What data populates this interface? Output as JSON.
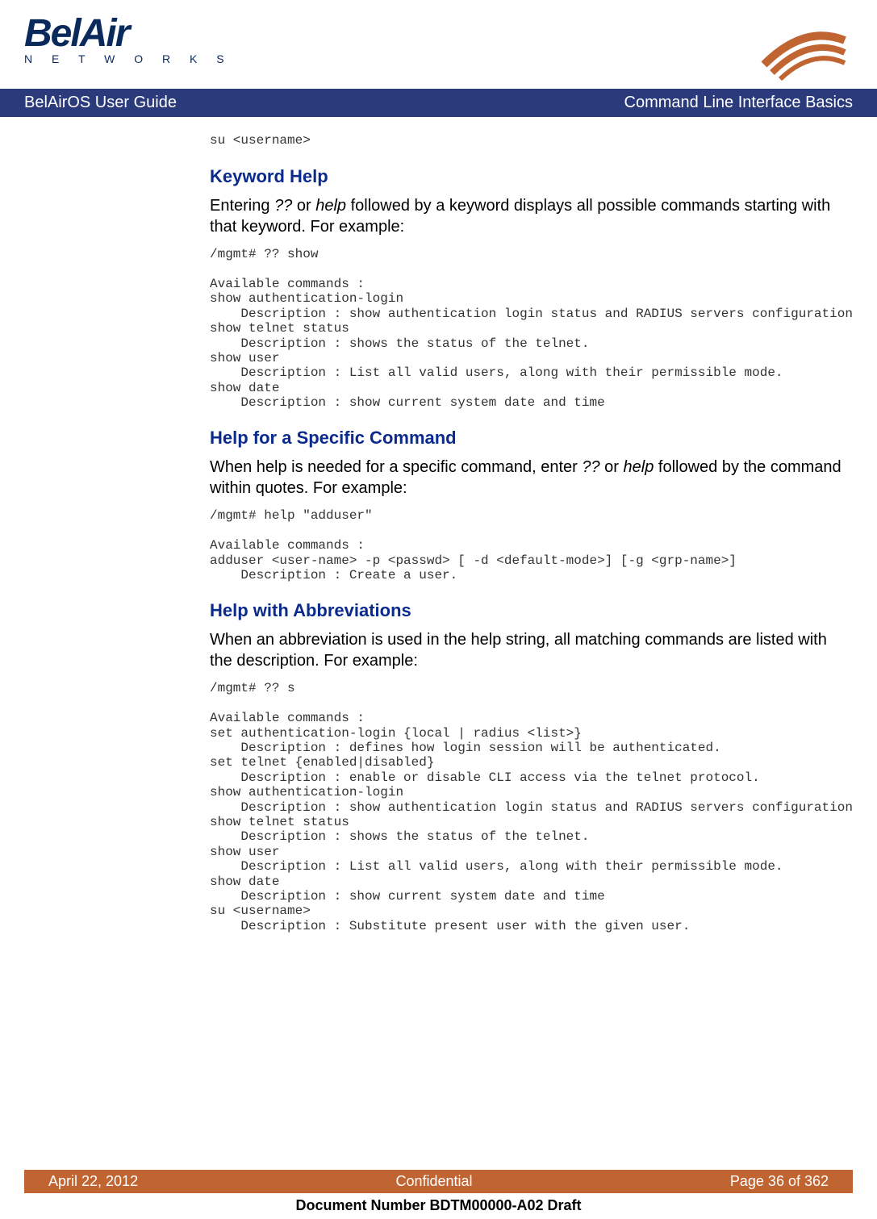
{
  "logo": {
    "main": "BelAir",
    "sub": "N E T W O R K S"
  },
  "titlebar": {
    "left": "BelAirOS User Guide",
    "right": "Command Line Interface Basics"
  },
  "codeTop": "su <username>",
  "sectionA": {
    "heading": "Keyword Help",
    "para_pre": "Entering ",
    "para_q": "??",
    "para_mid1": " or ",
    "para_help": "help",
    "para_post": " followed by a keyword displays all possible commands starting with that keyword. For example:",
    "code": "/mgmt# ?? show\n\nAvailable commands :\nshow authentication-login\n    Description : show authentication login status and RADIUS servers configuration\nshow telnet status\n    Description : shows the status of the telnet.\nshow user\n    Description : List all valid users, along with their permissible mode.\nshow date\n    Description : show current system date and time"
  },
  "sectionB": {
    "heading": "Help for a Specific Command",
    "para_pre": "When help is needed for a specific command, enter  ",
    "para_q": "??",
    "para_mid1": " or ",
    "para_help": "help",
    "para_post": " followed by the command within quotes. For example:",
    "code": "/mgmt# help \"adduser\"\n\nAvailable commands :\nadduser <user-name> -p <passwd> [ -d <default-mode>] [-g <grp-name>]\n    Description : Create a user."
  },
  "sectionC": {
    "heading": "Help with Abbreviations",
    "para": "When an abbreviation is used in the help string, all matching commands are listed with the description. For example:",
    "code": "/mgmt# ?? s\n\nAvailable commands :\nset authentication-login {local | radius <list>}\n    Description : defines how login session will be authenticated.\nset telnet {enabled|disabled}\n    Description : enable or disable CLI access via the telnet protocol.\nshow authentication-login\n    Description : show authentication login status and RADIUS servers configuration\nshow telnet status\n    Description : shows the status of the telnet.\nshow user\n    Description : List all valid users, along with their permissible mode.\nshow date\n    Description : show current system date and time\nsu <username>\n    Description : Substitute present user with the given user."
  },
  "footer": {
    "left": "April 22, 2012",
    "center": "Confidential",
    "right": "Page 36 of 362"
  },
  "docnum": "Document Number BDTM00000-A02 Draft"
}
